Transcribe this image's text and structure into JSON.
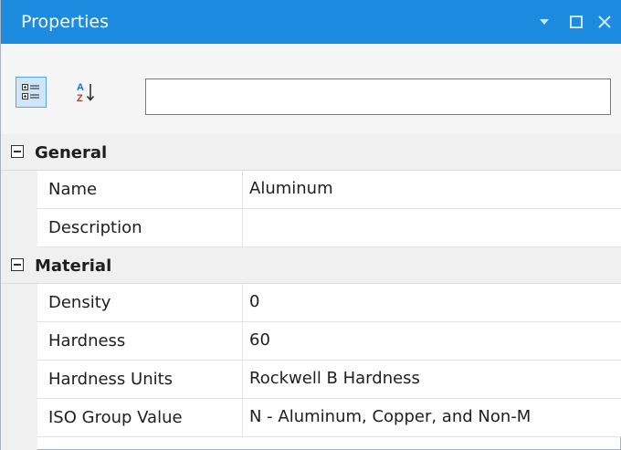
{
  "window": {
    "title": "Properties",
    "controls": {
      "menu_icon": "dropdown-arrow-icon",
      "maximize_icon": "maximize-icon",
      "close_icon": "close-icon"
    }
  },
  "toolbar": {
    "categorized_icon": "categorized-view-icon",
    "alphabetical_icon": "sort-alphabetical-icon",
    "search": {
      "value": "",
      "placeholder": ""
    }
  },
  "categories": [
    {
      "label": "General",
      "expanded": true,
      "properties": [
        {
          "name": "Name",
          "value": "Aluminum"
        },
        {
          "name": "Description",
          "value": ""
        }
      ]
    },
    {
      "label": "Material",
      "expanded": true,
      "properties": [
        {
          "name": "Density",
          "value": "0"
        },
        {
          "name": "Hardness",
          "value": "60"
        },
        {
          "name": "Hardness Units",
          "value": "Rockwell B Hardness"
        },
        {
          "name": "ISO Group Value",
          "value": "N - Aluminum, Copper, and Non-M"
        }
      ]
    }
  ],
  "colors": {
    "title_bar": "#1c8be0",
    "toolbar_bg": "#f5f5f5",
    "category_bg": "#f0f0f0",
    "selected_button_bg": "#cfe6fa",
    "selected_button_border": "#5aa5e6"
  }
}
